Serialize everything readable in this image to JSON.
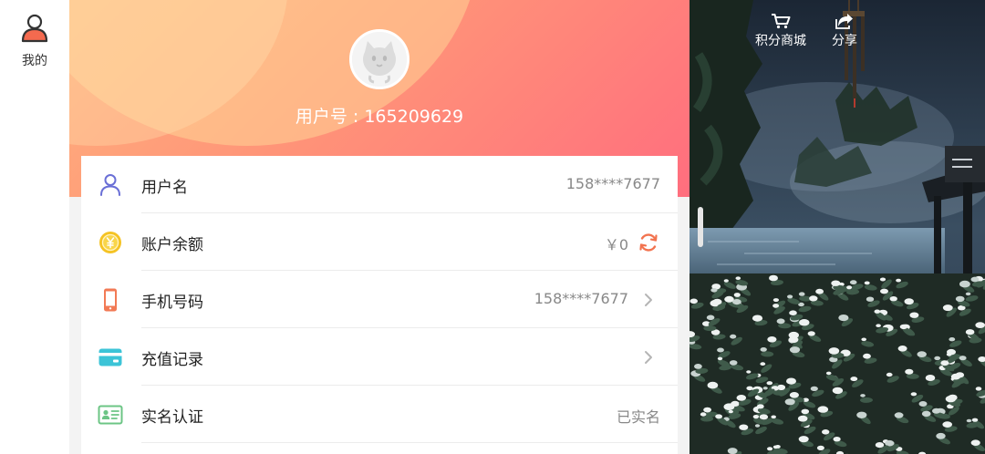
{
  "nav": {
    "mine_label": "我的",
    "mine_icon": "user-icon"
  },
  "profile": {
    "user_id_text": "用户号 : 165209629",
    "avatar_icon": "cat-avatar"
  },
  "account_rows": [
    {
      "label": "用户名",
      "value": "158****7677",
      "icon": "user-outline-icon",
      "icon_color": "#6a6fd6"
    },
    {
      "label": "账户余额",
      "value": "￥0",
      "icon": "coin-icon",
      "icon_color": "#f5c324",
      "extra_icon": "refresh-icon",
      "extra_color": "#f2734f"
    },
    {
      "label": "手机号码",
      "value": "158****7677",
      "icon": "phone-icon",
      "icon_color": "#f27a55",
      "extra_icon": "chevron-right-icon"
    },
    {
      "label": "充值记录",
      "value": "",
      "icon": "card-icon",
      "icon_color": "#3cc4d7",
      "extra_icon": "chevron-right-icon"
    },
    {
      "label": "实名认证",
      "value": "已实名",
      "icon": "id-card-icon",
      "icon_color": "#6cc585"
    }
  ],
  "scene_actions": {
    "shop_label": "积分商城",
    "shop_icon": "cart-icon",
    "share_label": "分享",
    "share_icon": "share-icon"
  },
  "colors": {
    "hero_start": "#ffb27d",
    "hero_end": "#ff6e7e",
    "nav_icon_fill": "#f46a4f"
  }
}
